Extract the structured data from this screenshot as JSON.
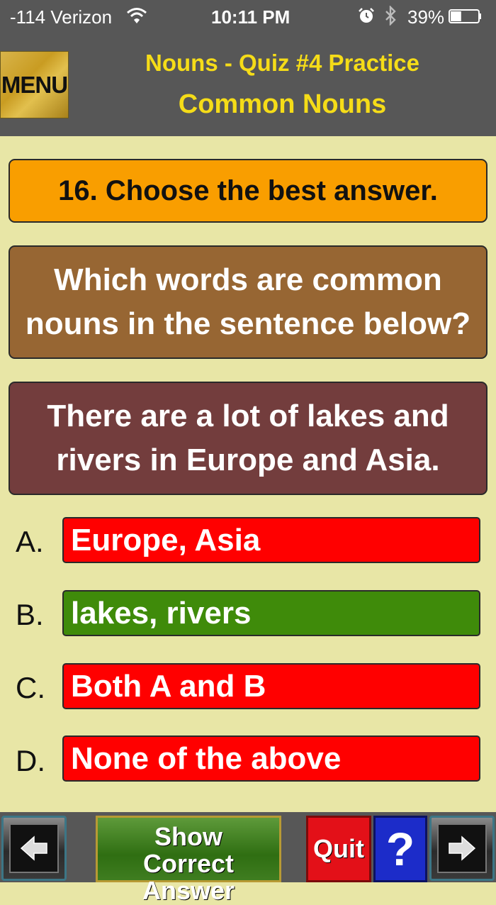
{
  "status_bar": {
    "carrier": "-114 Verizon",
    "time": "10:11 PM",
    "battery_percent": "39%",
    "battery_level": 0.39
  },
  "header": {
    "menu_label": "MENU",
    "title": "Nouns - Quiz #4 Practice",
    "subtitle": "Common Nouns"
  },
  "quiz": {
    "instruction": "16. Choose the best answer.",
    "question": "Which words are common nouns in the sentence below?",
    "sentence": "There are a lot of lakes and rivers in Europe and Asia.",
    "options": [
      {
        "letter": "A.",
        "text": "Europe, Asia",
        "color": "#ff0000"
      },
      {
        "letter": "B.",
        "text": "lakes, rivers",
        "color": "#3f8b0a"
      },
      {
        "letter": "C.",
        "text": "Both A and B",
        "color": "#ff0000"
      },
      {
        "letter": "D.",
        "text": "None of the above",
        "color": "#ff0000"
      }
    ]
  },
  "toolbar": {
    "show_answer_line1": "Show",
    "show_answer_line2": "Correct Answer",
    "quit_label": "Quit",
    "help_label": "?",
    "back_icon": "arrow-left-icon",
    "next_icon": "arrow-right-icon"
  },
  "colors": {
    "background": "#e8e6a6",
    "header_bg": "#575757",
    "title_yellow": "#f5dc18",
    "instruction_bg": "#f99e00",
    "question_bg": "#976633",
    "sentence_bg": "#733d3d"
  }
}
